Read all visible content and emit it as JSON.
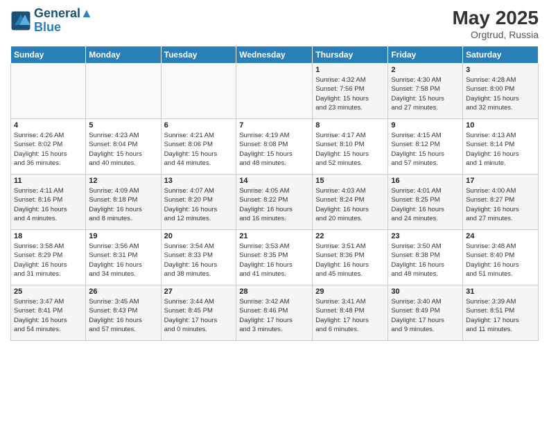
{
  "header": {
    "logo_line1": "General",
    "logo_line2": "Blue",
    "month_year": "May 2025",
    "location": "Orgtrud, Russia"
  },
  "weekdays": [
    "Sunday",
    "Monday",
    "Tuesday",
    "Wednesday",
    "Thursday",
    "Friday",
    "Saturday"
  ],
  "weeks": [
    [
      {
        "day": "",
        "info": ""
      },
      {
        "day": "",
        "info": ""
      },
      {
        "day": "",
        "info": ""
      },
      {
        "day": "",
        "info": ""
      },
      {
        "day": "1",
        "info": "Sunrise: 4:32 AM\nSunset: 7:56 PM\nDaylight: 15 hours\nand 23 minutes."
      },
      {
        "day": "2",
        "info": "Sunrise: 4:30 AM\nSunset: 7:58 PM\nDaylight: 15 hours\nand 27 minutes."
      },
      {
        "day": "3",
        "info": "Sunrise: 4:28 AM\nSunset: 8:00 PM\nDaylight: 15 hours\nand 32 minutes."
      }
    ],
    [
      {
        "day": "4",
        "info": "Sunrise: 4:26 AM\nSunset: 8:02 PM\nDaylight: 15 hours\nand 36 minutes."
      },
      {
        "day": "5",
        "info": "Sunrise: 4:23 AM\nSunset: 8:04 PM\nDaylight: 15 hours\nand 40 minutes."
      },
      {
        "day": "6",
        "info": "Sunrise: 4:21 AM\nSunset: 8:06 PM\nDaylight: 15 hours\nand 44 minutes."
      },
      {
        "day": "7",
        "info": "Sunrise: 4:19 AM\nSunset: 8:08 PM\nDaylight: 15 hours\nand 48 minutes."
      },
      {
        "day": "8",
        "info": "Sunrise: 4:17 AM\nSunset: 8:10 PM\nDaylight: 15 hours\nand 52 minutes."
      },
      {
        "day": "9",
        "info": "Sunrise: 4:15 AM\nSunset: 8:12 PM\nDaylight: 15 hours\nand 57 minutes."
      },
      {
        "day": "10",
        "info": "Sunrise: 4:13 AM\nSunset: 8:14 PM\nDaylight: 16 hours\nand 1 minute."
      }
    ],
    [
      {
        "day": "11",
        "info": "Sunrise: 4:11 AM\nSunset: 8:16 PM\nDaylight: 16 hours\nand 4 minutes."
      },
      {
        "day": "12",
        "info": "Sunrise: 4:09 AM\nSunset: 8:18 PM\nDaylight: 16 hours\nand 8 minutes."
      },
      {
        "day": "13",
        "info": "Sunrise: 4:07 AM\nSunset: 8:20 PM\nDaylight: 16 hours\nand 12 minutes."
      },
      {
        "day": "14",
        "info": "Sunrise: 4:05 AM\nSunset: 8:22 PM\nDaylight: 16 hours\nand 16 minutes."
      },
      {
        "day": "15",
        "info": "Sunrise: 4:03 AM\nSunset: 8:24 PM\nDaylight: 16 hours\nand 20 minutes."
      },
      {
        "day": "16",
        "info": "Sunrise: 4:01 AM\nSunset: 8:25 PM\nDaylight: 16 hours\nand 24 minutes."
      },
      {
        "day": "17",
        "info": "Sunrise: 4:00 AM\nSunset: 8:27 PM\nDaylight: 16 hours\nand 27 minutes."
      }
    ],
    [
      {
        "day": "18",
        "info": "Sunrise: 3:58 AM\nSunset: 8:29 PM\nDaylight: 16 hours\nand 31 minutes."
      },
      {
        "day": "19",
        "info": "Sunrise: 3:56 AM\nSunset: 8:31 PM\nDaylight: 16 hours\nand 34 minutes."
      },
      {
        "day": "20",
        "info": "Sunrise: 3:54 AM\nSunset: 8:33 PM\nDaylight: 16 hours\nand 38 minutes."
      },
      {
        "day": "21",
        "info": "Sunrise: 3:53 AM\nSunset: 8:35 PM\nDaylight: 16 hours\nand 41 minutes."
      },
      {
        "day": "22",
        "info": "Sunrise: 3:51 AM\nSunset: 8:36 PM\nDaylight: 16 hours\nand 45 minutes."
      },
      {
        "day": "23",
        "info": "Sunrise: 3:50 AM\nSunset: 8:38 PM\nDaylight: 16 hours\nand 48 minutes."
      },
      {
        "day": "24",
        "info": "Sunrise: 3:48 AM\nSunset: 8:40 PM\nDaylight: 16 hours\nand 51 minutes."
      }
    ],
    [
      {
        "day": "25",
        "info": "Sunrise: 3:47 AM\nSunset: 8:41 PM\nDaylight: 16 hours\nand 54 minutes."
      },
      {
        "day": "26",
        "info": "Sunrise: 3:45 AM\nSunset: 8:43 PM\nDaylight: 16 hours\nand 57 minutes."
      },
      {
        "day": "27",
        "info": "Sunrise: 3:44 AM\nSunset: 8:45 PM\nDaylight: 17 hours\nand 0 minutes."
      },
      {
        "day": "28",
        "info": "Sunrise: 3:42 AM\nSunset: 8:46 PM\nDaylight: 17 hours\nand 3 minutes."
      },
      {
        "day": "29",
        "info": "Sunrise: 3:41 AM\nSunset: 8:48 PM\nDaylight: 17 hours\nand 6 minutes."
      },
      {
        "day": "30",
        "info": "Sunrise: 3:40 AM\nSunset: 8:49 PM\nDaylight: 17 hours\nand 9 minutes."
      },
      {
        "day": "31",
        "info": "Sunrise: 3:39 AM\nSunset: 8:51 PM\nDaylight: 17 hours\nand 11 minutes."
      }
    ]
  ]
}
